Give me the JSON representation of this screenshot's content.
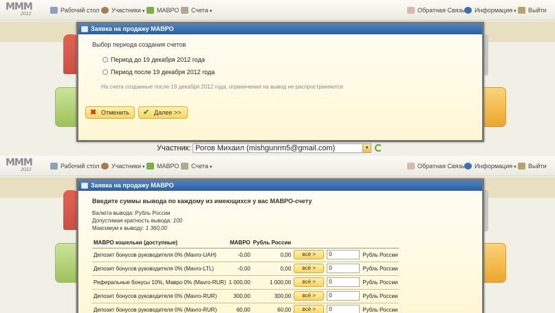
{
  "logo": {
    "letters": "МММ",
    "year": "2012"
  },
  "nav": {
    "desktop": "Рабочий стол",
    "participants": "Участники",
    "mavro": "МАВРО",
    "accounts": "Счета",
    "feedback": "Обратная Связь",
    "info": "Информация",
    "logout": "Выйти",
    "caret": "▾"
  },
  "dialog1": {
    "title": "Заявка на продажу МАВРО",
    "heading": "Выбор периода создания счетов",
    "option1": "Период до 19 декабря 2012 года",
    "option2": "Период после 19 декабря 2012 года",
    "note": "На счета созданные после 19 декабря 2012 года, ограничения на вывод не распространяются",
    "cancel": "Отменить",
    "next": "Далее >>"
  },
  "participant": {
    "label": "Участник:",
    "value": "Рогов Михаил (mishgunrm5@gmail.com)",
    "arrow": "▾"
  },
  "dialog2": {
    "title": "Заявка на продажу МАВРО",
    "heading": "Введите суммы вывода по каждому из имеющихся у вас МАВРО-счету",
    "currency": "Валюта вывода: Рубль России",
    "multiple_label": "Допустимая кратность вывода:",
    "multiple_value": "100",
    "max_label": "Максимум к выводу:",
    "max_value": "1 360,00",
    "columns": [
      "МАВРО кошельки (доступные)",
      "МАВРО",
      "Рубль России"
    ],
    "all_label": "всё >",
    "rows": [
      {
        "name": "Депозит бонусов руководителя 0% (Mavro-UAH)",
        "mavro": "-0,00",
        "rub": "0,00",
        "input": "0",
        "currency": "Рубль России"
      },
      {
        "name": "Депозит бонусов руководителя 0% (Mavro-LTL)",
        "mavro": "-0,00",
        "rub": "0,00",
        "input": "0",
        "currency": "Рубль России"
      },
      {
        "name": "Реферальные бонусы 10%, Мавро 0% (Mavro-RUR)",
        "mavro": "1 000,00",
        "rub": "1 000,00",
        "input": "0",
        "currency": "Рубль России"
      },
      {
        "name": "Депозит бонусов руководителя 0% (Mavro-RUR)",
        "mavro": "300,00",
        "rub": "300,00",
        "input": "0",
        "currency": "Рубль России"
      },
      {
        "name": "Депозит бонусов руководителя 0% (Mavro-RUR)",
        "mavro": "60,00",
        "rub": "60,00",
        "input": "0",
        "currency": "Рубль России"
      }
    ]
  },
  "icons": {
    "cancel": "✖",
    "next": "✔"
  },
  "colors": {
    "title_bar": "#2c5f9f",
    "button": "#fbd460",
    "dialog_bg": "#fffbe6"
  }
}
